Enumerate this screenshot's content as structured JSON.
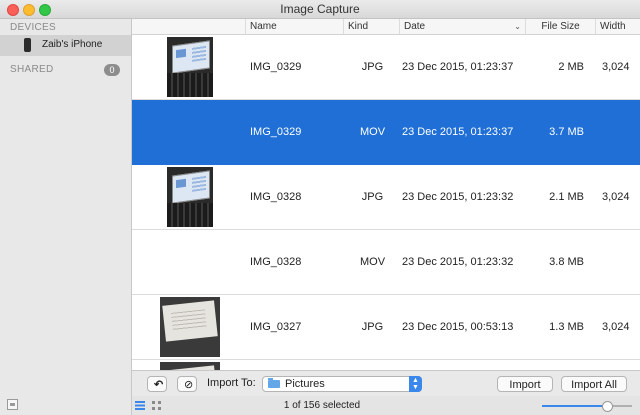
{
  "window": {
    "title": "Image Capture"
  },
  "sidebar": {
    "devices_header": "DEVICES",
    "device_name": "Zaib's iPhone",
    "shared_header": "SHARED",
    "shared_count": "0"
  },
  "columns": {
    "name": "Name",
    "kind": "Kind",
    "date": "Date",
    "size": "File Size",
    "width": "Width"
  },
  "rows": [
    {
      "name": "IMG_0329",
      "kind": "JPG",
      "date": "23 Dec 2015, 01:23:37",
      "size": "2 MB",
      "width": "3,024"
    },
    {
      "name": "IMG_0329",
      "kind": "MOV",
      "date": "23 Dec 2015, 01:23:37",
      "size": "3.7 MB",
      "width": ""
    },
    {
      "name": "IMG_0328",
      "kind": "JPG",
      "date": "23 Dec 2015, 01:23:32",
      "size": "2.1 MB",
      "width": "3,024"
    },
    {
      "name": "IMG_0328",
      "kind": "MOV",
      "date": "23 Dec 2015, 01:23:32",
      "size": "3.8 MB",
      "width": ""
    },
    {
      "name": "IMG_0327",
      "kind": "JPG",
      "date": "23 Dec 2015, 00:53:13",
      "size": "1.3 MB",
      "width": "3,024"
    }
  ],
  "toolbar": {
    "import_to_label": "Import To:",
    "import_destination": "Pictures",
    "import_label": "Import",
    "import_all_label": "Import All"
  },
  "status": {
    "selection_text": "1 of 156 selected"
  },
  "colors": {
    "selection": "#1f6fd6",
    "accent": "#3b88ec"
  }
}
